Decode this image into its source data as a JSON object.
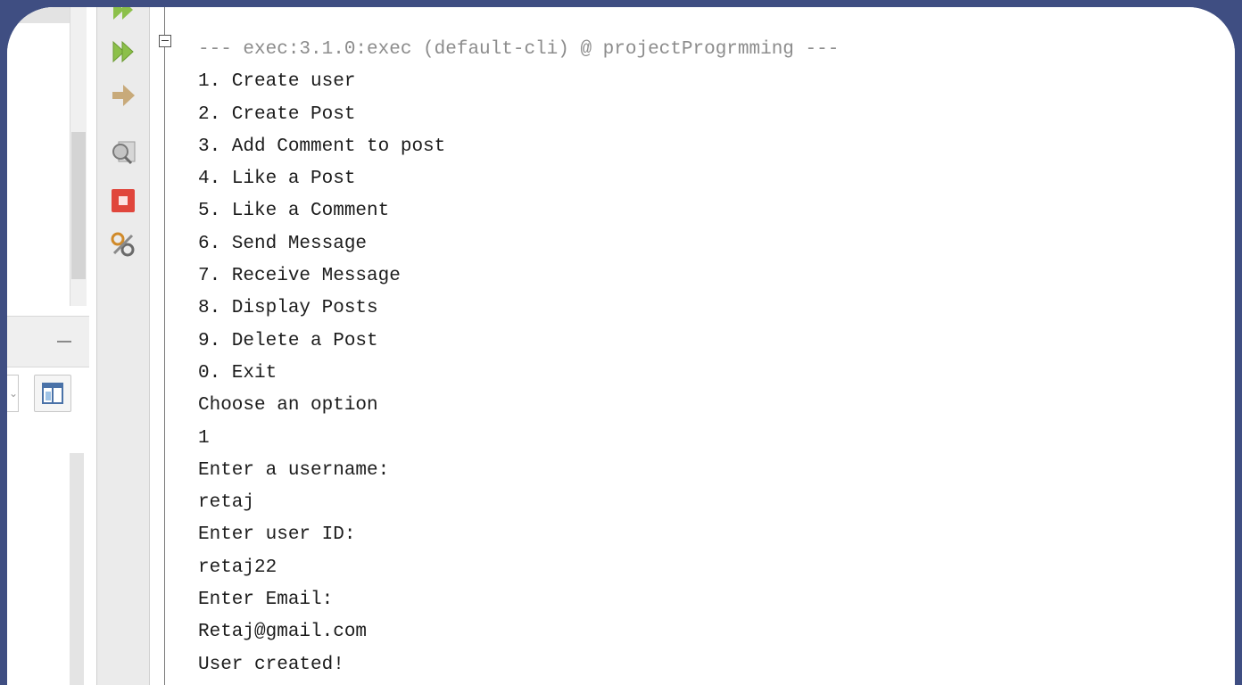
{
  "navigator": {
    "minimize_symbol": "—",
    "combo_chevron": "⌄"
  },
  "toolbar": {
    "buttons": [
      {
        "icon": "rerun-icon",
        "color": "#8cc04a"
      },
      {
        "icon": "rerun-with-options-icon",
        "color": "#8cc04a"
      },
      {
        "icon": "continue-arrow-icon",
        "color": "#c8aa7a"
      },
      {
        "icon": "find-icon",
        "color": "#9a9a9a"
      },
      {
        "icon": "stop-icon",
        "color": "#e0463c"
      },
      {
        "icon": "settings-icon",
        "color": "#d08a2a"
      }
    ]
  },
  "output": {
    "header": "--- exec:3.1.0:exec (default-cli) @ projectProgrmming ---",
    "lines": [
      "1. Create user",
      "2. Create Post",
      "3. Add Comment to post",
      "4. Like a Post",
      "5. Like a Comment",
      "6. Send Message",
      "7. Receive Message",
      "8. Display Posts",
      "9. Delete a Post",
      "0. Exit",
      "Choose an option",
      "1",
      "Enter a username:",
      "retaj",
      "Enter user ID:",
      "retaj22",
      "Enter Email:",
      "Retaj@gmail.com",
      "User created!"
    ]
  }
}
